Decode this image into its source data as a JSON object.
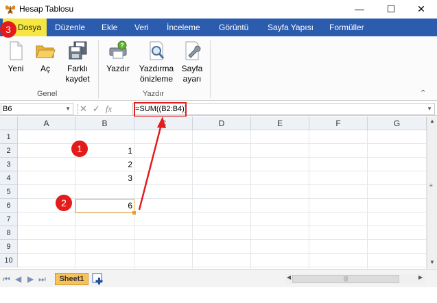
{
  "window": {
    "title": "Hesap Tablosu",
    "minimize_glyph": "—",
    "maximize_glyph": "☐",
    "close_glyph": "✕"
  },
  "tabs": [
    {
      "label": "Dosya"
    },
    {
      "label": "Düzenle"
    },
    {
      "label": "Ekle"
    },
    {
      "label": "Veri"
    },
    {
      "label": "İnceleme"
    },
    {
      "label": "Görüntü"
    },
    {
      "label": "Sayfa Yapısı"
    },
    {
      "label": "Formüller"
    }
  ],
  "ribbon": {
    "groups": [
      {
        "label": "Genel"
      },
      {
        "label": "Yazdır"
      }
    ],
    "buttons": [
      {
        "label_line1": "Yeni",
        "label_line2": "",
        "icon": "new-document-icon"
      },
      {
        "label_line1": "Aç",
        "label_line2": "",
        "icon": "open-folder-icon"
      },
      {
        "label_line1": "Farklı",
        "label_line2": "kaydet",
        "icon": "save-as-icon"
      },
      {
        "label_line1": "Yazdır",
        "label_line2": "",
        "icon": "printer-icon"
      },
      {
        "label_line1": "Yazdırma",
        "label_line2": "önizleme",
        "icon": "print-preview-icon"
      },
      {
        "label_line1": "Sayfa",
        "label_line2": "ayarı",
        "icon": "page-setup-icon"
      }
    ]
  },
  "formula_bar": {
    "cell_ref": "B6",
    "formula": "=SUM((B2:B4))",
    "cancel_glyph": "✕",
    "accept_glyph": "✓",
    "fx_label": "fx"
  },
  "grid": {
    "columns": [
      "A",
      "B",
      "C",
      "D",
      "E",
      "F",
      "G"
    ],
    "rows": [
      "1",
      "2",
      "3",
      "4",
      "5",
      "6",
      "7",
      "8",
      "9",
      "10"
    ],
    "cells": [
      {
        "ref": "B2",
        "value": "1"
      },
      {
        "ref": "B3",
        "value": "2"
      },
      {
        "ref": "B4",
        "value": "3"
      },
      {
        "ref": "B6",
        "value": "6"
      }
    ],
    "selected_cell": "B6"
  },
  "sheets": {
    "tabs": [
      {
        "label": "Sheet1"
      }
    ],
    "scroll_thumb_glyph": "|||"
  },
  "annotations": {
    "badges": [
      "1",
      "2",
      "3"
    ],
    "accent_color": "#e31b1b"
  },
  "colors": {
    "tab_bar": "#2c5cae",
    "file_tab": "#f5e642",
    "selection": "#f0a020",
    "sheet_tab": "#f7c25a"
  }
}
